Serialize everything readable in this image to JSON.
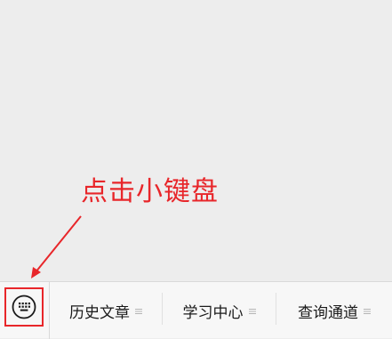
{
  "annotation": {
    "text": "点击小键盘"
  },
  "menu": {
    "items": [
      {
        "label": "历史文章"
      },
      {
        "label": "学习中心"
      },
      {
        "label": "查询通道"
      }
    ]
  },
  "colors": {
    "annotation": "#e8262a",
    "menu_text": "#1a1a1a",
    "background": "#ededed",
    "menu_background": "#f7f7f7"
  },
  "icons": {
    "keyboard": "keyboard-icon",
    "submenu": "menu-lines-icon"
  }
}
